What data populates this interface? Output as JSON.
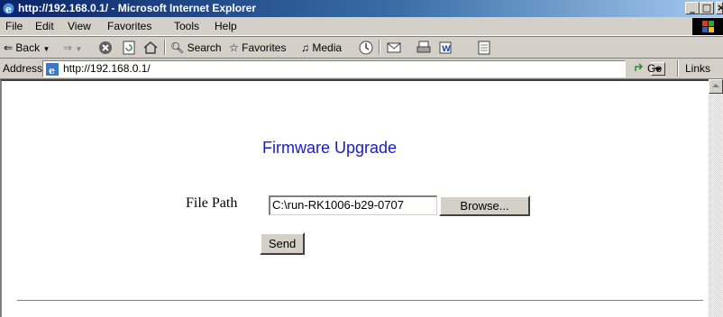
{
  "window": {
    "title": "http://192.168.0.1/ - Microsoft Internet Explorer",
    "minimize_icon": "minimize-icon",
    "maximize_icon": "maximize-icon",
    "close_icon": "close-icon"
  },
  "menubar": {
    "items": [
      "File",
      "Edit",
      "View",
      "Favorites",
      "Tools",
      "Help"
    ]
  },
  "toolbar": {
    "back_label": "Back",
    "search_label": "Search",
    "favorites_label": "Favorites",
    "media_label": "Media"
  },
  "addressbar": {
    "label": "Address",
    "url": "http://192.168.0.1/",
    "go_label": "Go",
    "links_label": "Links"
  },
  "page": {
    "heading": "Firmware Upgrade",
    "file_path_label": "File Path",
    "file_path_value": "C:\\run-RK1006-b29-0707",
    "browse_label": "Browse...",
    "send_label": "Send"
  },
  "colors": {
    "heading": "#1a1acd",
    "chrome": "#d4d0c8",
    "titlebar_start": "#0a246a",
    "titlebar_end": "#a6caf0"
  }
}
